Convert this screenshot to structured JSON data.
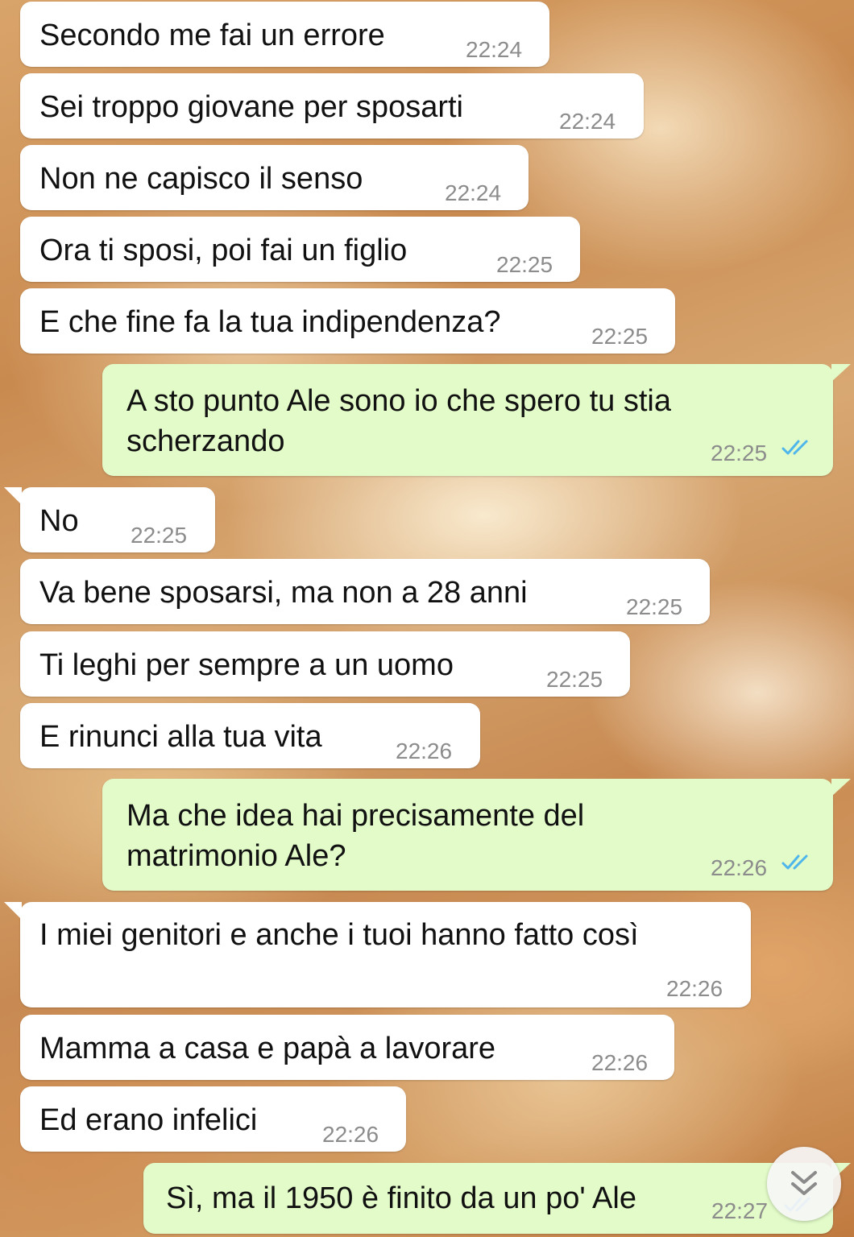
{
  "colors": {
    "incoming_bubble": "#ffffff",
    "outgoing_bubble": "#e2fbc8",
    "timestamp": "#8c8c8c",
    "read_ticks": "#4fb6ec"
  },
  "messages": [
    {
      "direction": "incoming",
      "text": "Secondo me fai un errore",
      "time": "22:24"
    },
    {
      "direction": "incoming",
      "text": "Sei troppo giovane per sposarti",
      "time": "22:24"
    },
    {
      "direction": "incoming",
      "text": "Non ne capisco il senso",
      "time": "22:24"
    },
    {
      "direction": "incoming",
      "text": "Ora ti sposi, poi fai un figlio",
      "time": "22:25"
    },
    {
      "direction": "incoming",
      "text": "E che fine fa la tua indipendenza?",
      "time": "22:25"
    },
    {
      "direction": "outgoing",
      "text": "A sto punto Ale sono io che spero tu stia scherzando",
      "time": "22:25",
      "status": "read"
    },
    {
      "direction": "incoming",
      "text": "No",
      "time": "22:25"
    },
    {
      "direction": "incoming",
      "text": "Va bene sposarsi, ma non a 28 anni",
      "time": "22:25"
    },
    {
      "direction": "incoming",
      "text": "Ti leghi per sempre a un uomo",
      "time": "22:25"
    },
    {
      "direction": "incoming",
      "text": "E rinunci alla tua vita",
      "time": "22:26"
    },
    {
      "direction": "outgoing",
      "text": "Ma che idea hai precisamente del matrimonio Ale?",
      "time": "22:26",
      "status": "read"
    },
    {
      "direction": "incoming",
      "text": "I miei genitori e anche i tuoi hanno fatto così",
      "time": "22:26"
    },
    {
      "direction": "incoming",
      "text": "Mamma a casa e papà a lavorare",
      "time": "22:26"
    },
    {
      "direction": "incoming",
      "text": "Ed erano infelici",
      "time": "22:26"
    },
    {
      "direction": "outgoing",
      "text": "Sì, ma il 1950 è finito da un po' Ale",
      "time": "22:27",
      "status": "read"
    }
  ],
  "scroll_button": {
    "icon": "double-chevron-down-icon"
  }
}
